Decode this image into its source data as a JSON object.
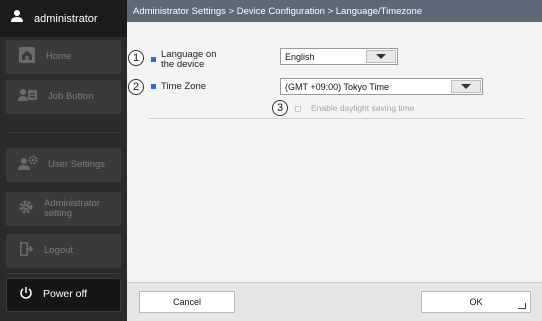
{
  "user": {
    "name": "administrator",
    "icon": "person-icon"
  },
  "sidebar": {
    "items": [
      {
        "label": "Home",
        "icon": "home-icon"
      },
      {
        "label": "Job Button",
        "icon": "job-icon"
      },
      {
        "label": "User Settings",
        "icon": "user-settings-icon"
      },
      {
        "label": "Administrator setting",
        "icon": "gear-icon"
      },
      {
        "label": "Logout",
        "icon": "logout-icon"
      },
      {
        "label": "Power off",
        "icon": "power-icon"
      }
    ]
  },
  "breadcrumb": "Administrator Settings > Device Configuration > Language/Timezone",
  "form": {
    "language": {
      "callout": "1",
      "label": "Language on the device",
      "value": "English"
    },
    "timezone": {
      "callout": "2",
      "label": "Time Zone",
      "value": "(GMT +09:00) Tokyo Time"
    },
    "daylight": {
      "callout": "3",
      "label": "Enable daylight saving time",
      "checked": false
    }
  },
  "footer": {
    "cancel_label": "Cancel",
    "ok_label": "OK"
  },
  "colors": {
    "accent": "#2a6dd4",
    "breadcrumb_bg": "#5b6a76",
    "sidebar_bg": "#2b2b2b"
  }
}
